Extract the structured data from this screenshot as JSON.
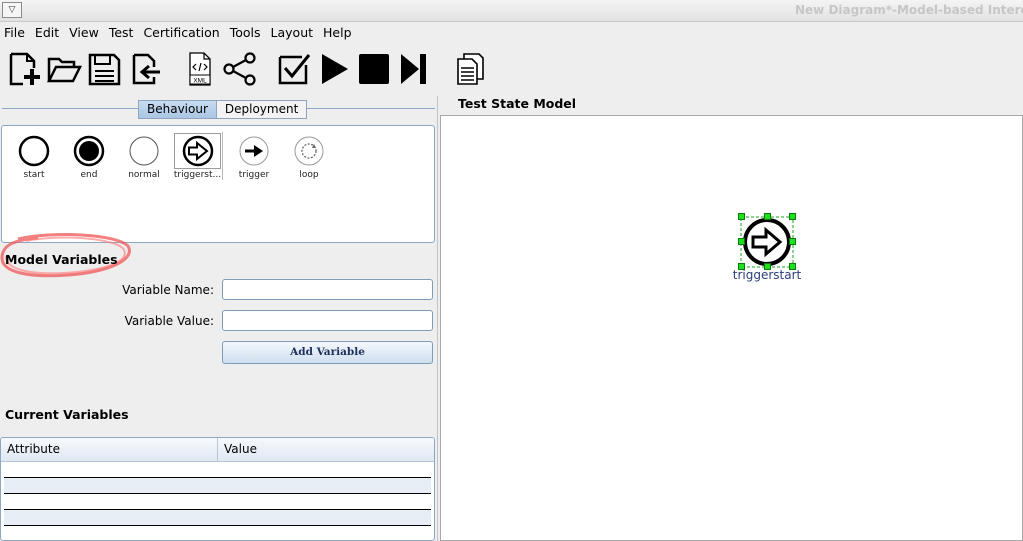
{
  "window": {
    "title": "New Diagram*-Model-based Interope"
  },
  "menu": [
    "File",
    "Edit",
    "View",
    "Test",
    "Certification",
    "Tools",
    "Layout",
    "Help"
  ],
  "toolbar": {
    "icons": [
      "new-diagram-icon",
      "open-folder-icon",
      "save-icon",
      "import-icon",
      "xml-export-icon",
      "share-icon",
      "validate-icon",
      "play-icon",
      "stop-icon",
      "step-forward-icon",
      "documents-icon"
    ],
    "xml_label": "XML"
  },
  "tabs": [
    {
      "label": "Behaviour",
      "active": true
    },
    {
      "label": "Deployment",
      "active": false
    }
  ],
  "palette": [
    {
      "label": "start",
      "icon": "start-circle-icon"
    },
    {
      "label": "end",
      "icon": "end-circle-icon"
    },
    {
      "label": "normal",
      "icon": "normal-circle-icon"
    },
    {
      "label": "triggerst...",
      "icon": "trigger-start-icon",
      "selected": true
    },
    {
      "label": "trigger",
      "icon": "trigger-arrow-icon"
    },
    {
      "label": "loop",
      "icon": "loop-icon"
    }
  ],
  "model_variables": {
    "heading": "Model Variables",
    "name_label": "Variable Name:",
    "value_label": "Variable Value:",
    "name_value": "",
    "value_value": "",
    "add_button": "Add Variable"
  },
  "current_variables": {
    "heading": "Current Variables",
    "columns": [
      "Attribute",
      "Value"
    ],
    "rows": []
  },
  "canvas": {
    "title": "Test State Model",
    "node_label": "triggerstart",
    "selection_color": "#1ee01e"
  }
}
